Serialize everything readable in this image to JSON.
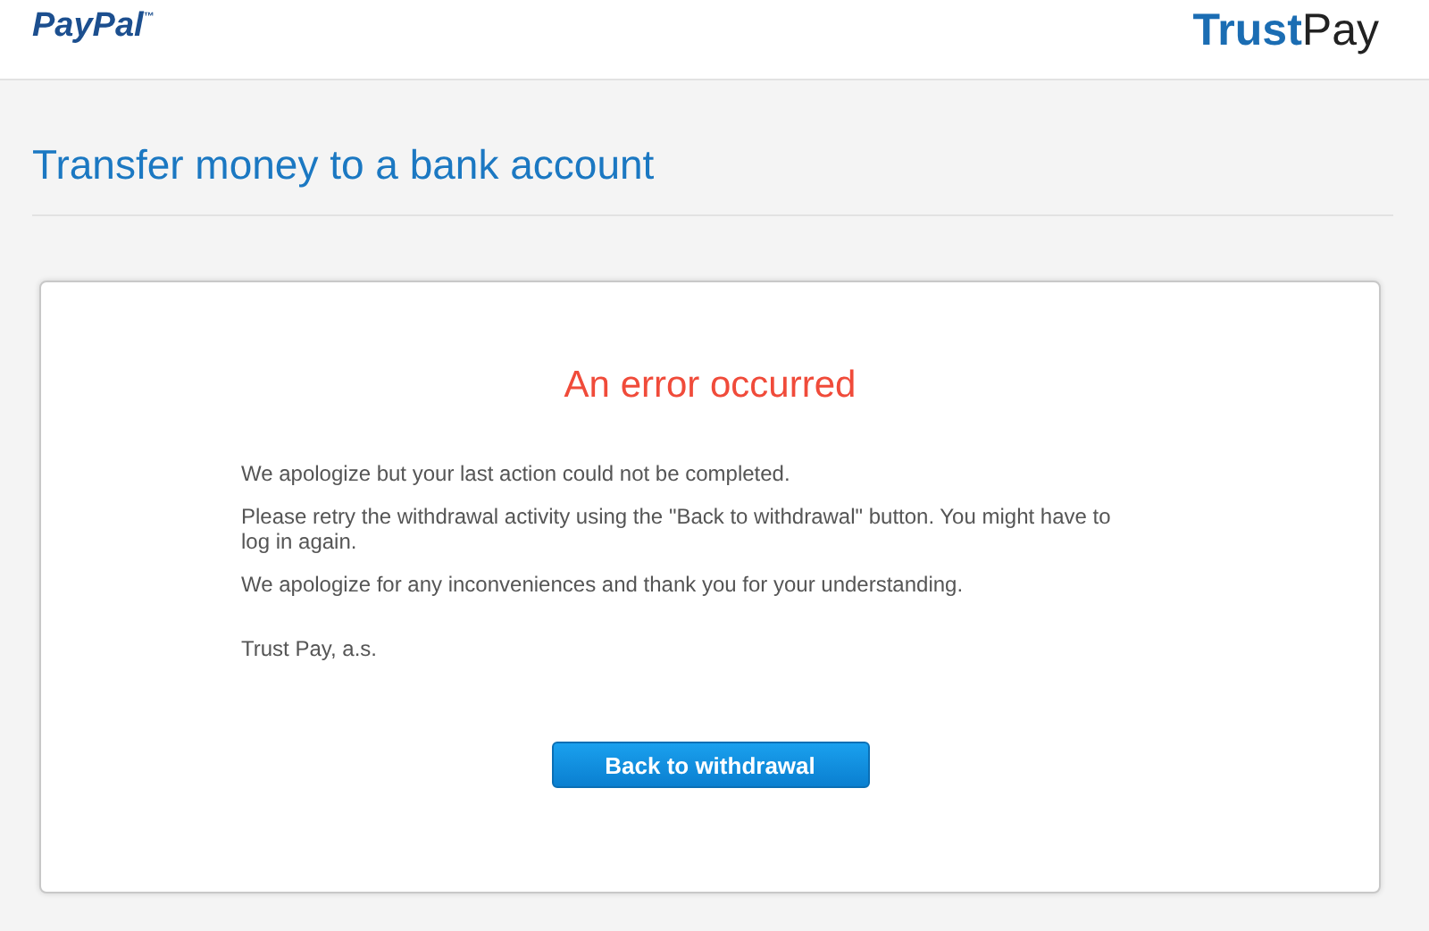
{
  "header": {
    "left_logo": {
      "text": "PayPal",
      "mark": "™"
    },
    "right_logo": {
      "parts": [
        {
          "text": "Trust",
          "bold": true
        },
        {
          "text": "Pay",
          "bold": false
        }
      ]
    }
  },
  "page_title": "Transfer money to a bank account",
  "card": {
    "heading": "An error occurred",
    "paragraphs": [
      "We apologize but your last action could not be completed.",
      "Please retry the withdrawal activity using the \"Back to withdrawal\" button. You might have to log in again.",
      "We apologize for any inconveniences and thank you for your understanding."
    ],
    "signature": "Trust Pay, a.s.",
    "button": "Back to withdrawal"
  }
}
